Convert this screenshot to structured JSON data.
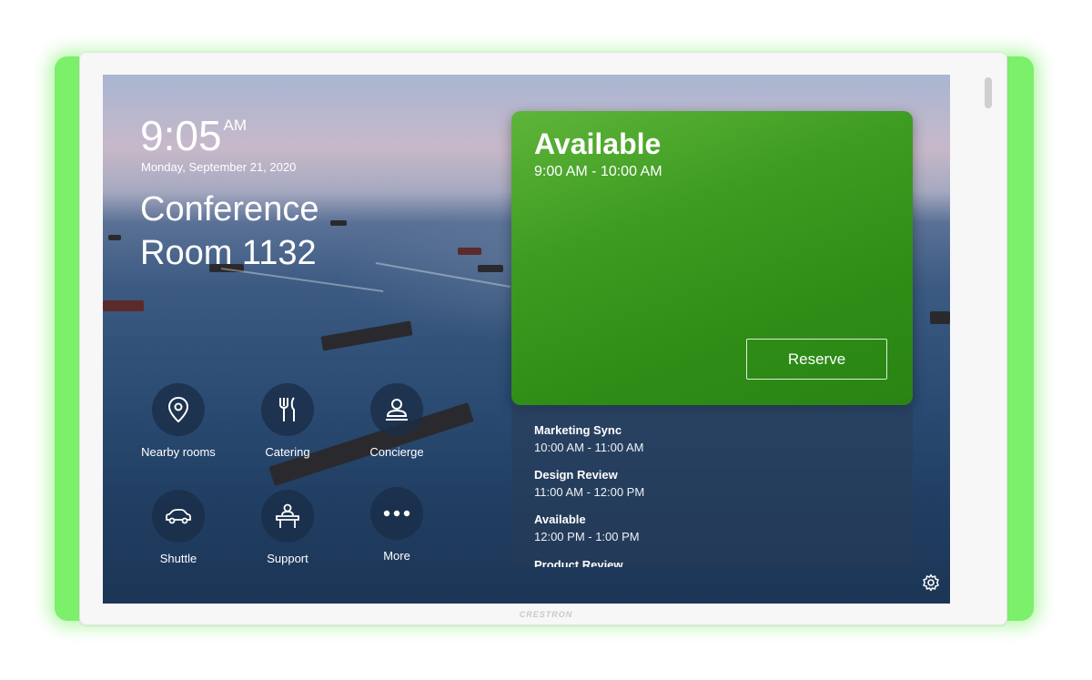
{
  "clock": {
    "time": "9:05",
    "ampm": "AM",
    "date": "Monday, September 21, 2020"
  },
  "room": {
    "name_line1": "Conference",
    "name_line2": "Room 1132"
  },
  "tiles": [
    {
      "label": "Nearby rooms",
      "icon": "location-pin-icon"
    },
    {
      "label": "Catering",
      "icon": "fork-knife-icon"
    },
    {
      "label": "Concierge",
      "icon": "concierge-person-icon"
    },
    {
      "label": "Shuttle",
      "icon": "car-icon"
    },
    {
      "label": "Support",
      "icon": "support-desk-icon"
    },
    {
      "label": "More",
      "icon": "more-dots-icon"
    }
  ],
  "status": {
    "label": "Available",
    "range": "9:00 AM - 10:00 AM",
    "reserve_label": "Reserve",
    "color": "#3e9c22"
  },
  "agenda": [
    {
      "title": "Marketing Sync",
      "range": "10:00 AM - 11:00 AM"
    },
    {
      "title": "Design Review",
      "range": "11:00 AM - 12:00 PM"
    },
    {
      "title": "Available",
      "range": "12:00 PM - 1:00 PM"
    },
    {
      "title": "Product Review",
      "range": ""
    }
  ],
  "device": {
    "brand": "CRESTRON",
    "glow_color": "#7cf06a"
  },
  "settings": {
    "icon": "gear-icon"
  }
}
